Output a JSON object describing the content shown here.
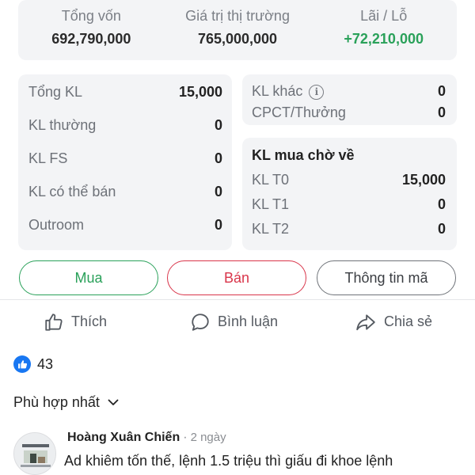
{
  "summary": {
    "capital": {
      "label": "Tổng vốn",
      "value": "692,790,000"
    },
    "market": {
      "label": "Giá trị thị trường",
      "value": "765,000,000"
    },
    "pnl": {
      "label": "Lãi / Lỗ",
      "value": "+72,210,000"
    }
  },
  "volumes_left": [
    {
      "label": "Tổng KL",
      "value": "15,000"
    },
    {
      "label": "KL thường",
      "value": "0"
    },
    {
      "label": "KL FS",
      "value": "0"
    },
    {
      "label": "KL có thể bán",
      "value": "0"
    },
    {
      "label": "Outroom",
      "value": "0"
    }
  ],
  "volumes_right_top": [
    {
      "label": "KL khác",
      "value": "0"
    },
    {
      "label": "CPCT/Thưởng",
      "value": "0"
    }
  ],
  "pending": {
    "title": "KL mua chờ về",
    "rows": [
      {
        "label": "KL T0",
        "value": "15,000"
      },
      {
        "label": "KL T1",
        "value": "0"
      },
      {
        "label": "KL T2",
        "value": "0"
      }
    ]
  },
  "buttons": {
    "buy": "Mua",
    "sell": "Bán",
    "info": "Thông tin mã"
  },
  "actions": {
    "like": "Thích",
    "comment": "Bình luận",
    "share": "Chia sẻ"
  },
  "reactions": {
    "count": "43"
  },
  "sort": {
    "label": "Phù hợp nhất"
  },
  "comment": {
    "author": "Hoàng Xuân Chiến",
    "time": "2 ngày",
    "text": "Ad khiêm tốn thế, lệnh 1.5 triệu thì giấu đi khoe lệnh"
  },
  "colors": {
    "positive": "#2aa15a",
    "negative": "#d9354a",
    "facebook_blue": "#1877f2"
  }
}
